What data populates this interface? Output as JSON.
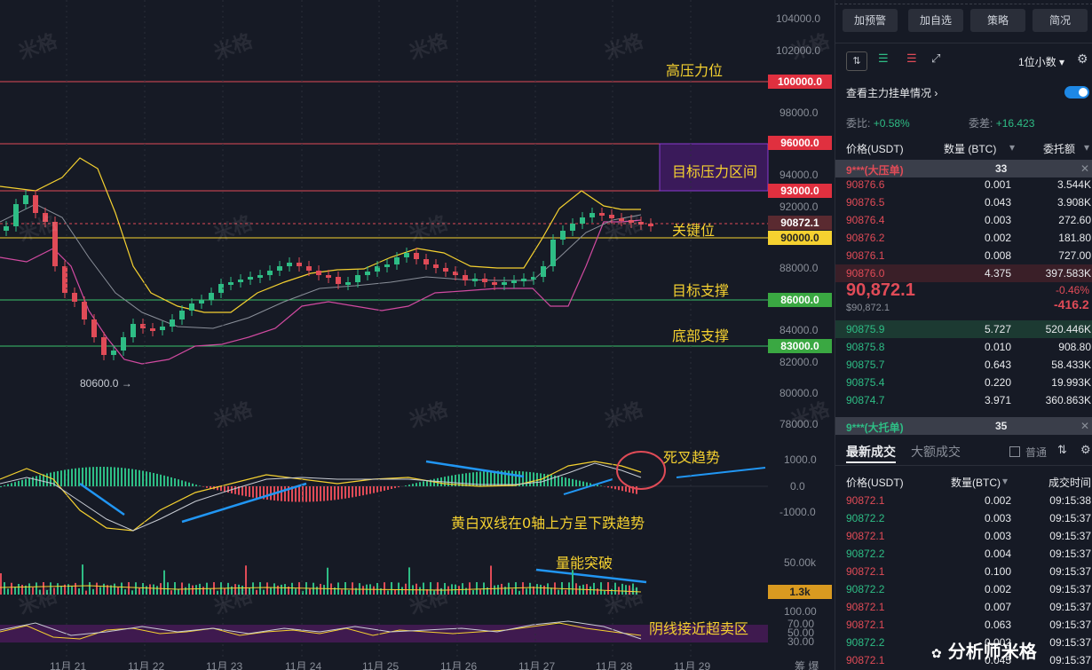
{
  "price_axis": [
    "104000.0",
    "102000.0",
    "100000.0",
    "98000.0",
    "96000.0",
    "94000.0",
    "93000.0",
    "92000.0",
    "90872.1",
    "90000.0",
    "88000.0",
    "86000.0",
    "84000.0",
    "83000.0",
    "82000.0",
    "80000.0",
    "78000.0"
  ],
  "macd_axis": [
    "1000.0",
    "0.0",
    "-1000.0"
  ],
  "vol_axis": [
    "50.00k",
    "1.3k"
  ],
  "rsi_axis": [
    "100.00",
    "70.00",
    "50.00",
    "30.00"
  ],
  "date_labels": [
    "11月 21",
    "11月 22",
    "11月 23",
    "11月 24",
    "11月 25",
    "11月 26",
    "11月 27",
    "11月 28",
    "11月 29"
  ],
  "tags": {
    "t100000": "100000.0",
    "t96000": "96000.0",
    "t93000": "93000.0",
    "t90872": "90872.1",
    "t90000": "90000.0",
    "t86000": "86000.0",
    "t83000": "83000.0",
    "t1_3k": "1.3k"
  },
  "annotations": {
    "high_pressure": "高压力位",
    "target_pressure_zone": "目标压力区间",
    "key_level": "关键位",
    "target_support": "目标支撑",
    "bottom_support": "底部支撑",
    "dead_cross": "死叉趋势",
    "macd_note": "黄白双线在0轴上方呈下跌趋势",
    "volume_break": "量能突破",
    "oversold": "阴线接近超卖区",
    "low_price": "80600.0 →"
  },
  "watermark": "米格",
  "watermark_footer": "分析师米格",
  "corner_label": "筹 爆",
  "colors": {
    "up": "#2ebd85",
    "down": "#e04b57",
    "yellow": "#f5d130",
    "purple": "#6a2a9a",
    "bg": "#161a25"
  },
  "panel": {
    "buttons": [
      "加预警",
      "加自选",
      "策略",
      "简况"
    ],
    "decimal_select": "1位小数",
    "view_orders": "查看主力挂单情况",
    "ratio_label": "委比:",
    "ratio_value": "+0.58%",
    "diff_label": "委差:",
    "diff_value": "+16.423",
    "headers": [
      "价格(USDT)",
      "数量 (BTC)",
      "委托额"
    ],
    "big_ask": {
      "label": "9***(大压单)",
      "count": "33"
    },
    "asks": [
      {
        "price": "90876.6",
        "qty": "0.001",
        "amount": "3.544K"
      },
      {
        "price": "90876.5",
        "qty": "0.043",
        "amount": "3.908K"
      },
      {
        "price": "90876.4",
        "qty": "0.003",
        "amount": "272.60"
      },
      {
        "price": "90876.2",
        "qty": "0.002",
        "amount": "181.80"
      },
      {
        "price": "90876.1",
        "qty": "0.008",
        "amount": "727.00"
      },
      {
        "price": "90876.0",
        "qty": "4.375",
        "amount": "397.583K"
      }
    ],
    "last_price": "90,872.1",
    "last_price_sub": "$90,872.1",
    "change_pct": "-0.46%",
    "change_val": "-416.2",
    "bids": [
      {
        "price": "90875.9",
        "qty": "5.727",
        "amount": "520.446K"
      },
      {
        "price": "90875.8",
        "qty": "0.010",
        "amount": "908.80"
      },
      {
        "price": "90875.7",
        "qty": "0.643",
        "amount": "58.433K"
      },
      {
        "price": "90875.4",
        "qty": "0.220",
        "amount": "19.993K"
      },
      {
        "price": "90874.7",
        "qty": "3.971",
        "amount": "360.863K"
      }
    ],
    "big_bid": {
      "label": "9***(大托单)",
      "count": "35"
    },
    "trade_tabs": [
      "最新成交",
      "大额成交"
    ],
    "normal_label": "普通",
    "trade_headers": [
      "价格(USDT)",
      "数量(BTC)",
      "成交时间"
    ],
    "trades": [
      {
        "price": "90872.1",
        "qty": "0.002",
        "time": "09:15:38",
        "side": "down"
      },
      {
        "price": "90872.2",
        "qty": "0.003",
        "time": "09:15:37",
        "side": "up"
      },
      {
        "price": "90872.1",
        "qty": "0.003",
        "time": "09:15:37",
        "side": "down"
      },
      {
        "price": "90872.2",
        "qty": "0.004",
        "time": "09:15:37",
        "side": "up"
      },
      {
        "price": "90872.1",
        "qty": "0.100",
        "time": "09:15:37",
        "side": "down"
      },
      {
        "price": "90872.2",
        "qty": "0.002",
        "time": "09:15:37",
        "side": "up"
      },
      {
        "price": "90872.1",
        "qty": "0.007",
        "time": "09:15:37",
        "side": "down"
      },
      {
        "price": "90872.1",
        "qty": "0.063",
        "time": "09:15:37",
        "side": "down"
      },
      {
        "price": "90872.2",
        "qty": "0.002",
        "time": "09:15:37",
        "side": "up"
      },
      {
        "price": "90872.1",
        "qty": "0.045",
        "time": "09:15:37",
        "side": "down"
      }
    ]
  },
  "chart_data": {
    "type": "line",
    "xlabels": [
      "11月 21",
      "11月 22",
      "11月 23",
      "11月 24",
      "11月 25",
      "11月 26",
      "11月 27",
      "11月 28",
      "11月 29"
    ],
    "price_levels": [
      100000,
      96000,
      93000,
      90000,
      86000,
      83000
    ],
    "current_price": 90872.1,
    "low_marker": 80600.0,
    "ylim": [
      78000,
      104000
    ]
  }
}
